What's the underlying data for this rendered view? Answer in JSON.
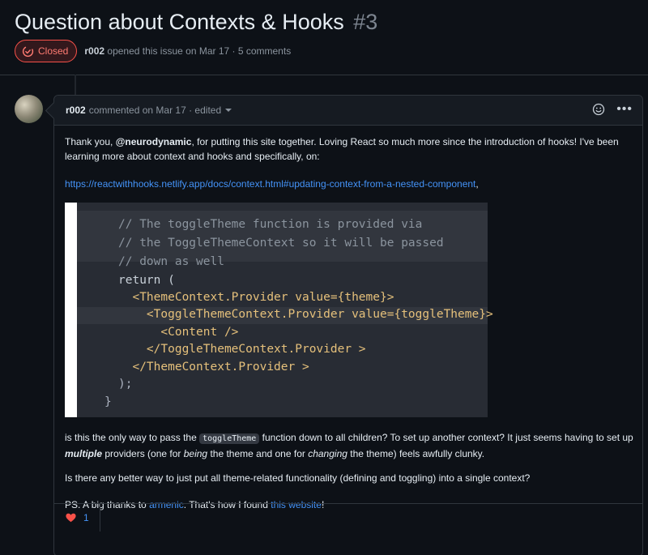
{
  "issue": {
    "title": "Question about Contexts & Hooks",
    "number": "#3",
    "status": "Closed",
    "author": "r002",
    "opened_text": "opened this issue on Mar 17 · 5 comments"
  },
  "comment": {
    "author": "r002",
    "meta": "commented on Mar 17 · edited",
    "p1_a": "Thank you, ",
    "p1_mention": "@neurodynamic",
    "p1_b": ", for putting this site together. Loving React so much more since the introduction of hooks! I've been learning more about context and hooks and specifically, on:",
    "link": "https://reactwithhooks.netlify.app/docs/context.html#updating-context-from-a-nested-component",
    "link_suffix": ",",
    "code_lines": [
      "// The toggleTheme function is provided via",
      "// the ToggleThemeContext so it will be passed",
      "// down as well",
      "return (",
      "  <ThemeContext.Provider value={theme}>",
      "    <ToggleThemeContext.Provider value={toggleTheme}>",
      "      <Content />",
      "    </ToggleThemeContext.Provider >",
      "  </ThemeContext.Provider >",
      ");",
      "}"
    ],
    "p3_a": "is this the only way to pass the ",
    "p3_code": "toggleTheme",
    "p3_b": " function down to all children? To set up another context? It just seems having to set up ",
    "p3_em1": "multiple",
    "p3_c": " providers (one for ",
    "p3_em2": "being",
    "p3_d": " the theme and one for ",
    "p3_em3": "changing",
    "p3_e": " the theme) feels awfully clunky.",
    "p4": "Is there any better way to just put all theme-related functionality (defining and toggling) into a single context?",
    "p5_a": "PS. A big thanks to ",
    "p5_link1": "armenic",
    "p5_b": ". That's how I found ",
    "p5_link2": "this website",
    "p5_c": "!",
    "reaction_count": "1"
  },
  "icons": {
    "status": "issue-closed-icon",
    "reaction": "heart-icon",
    "add_reaction": "smiley-icon",
    "more": "kebab-horizontal-icon"
  },
  "colors": {
    "background": "#0d1117",
    "closed_red": "#f85149",
    "link_blue": "#4493f8",
    "heart": "#f85149"
  }
}
